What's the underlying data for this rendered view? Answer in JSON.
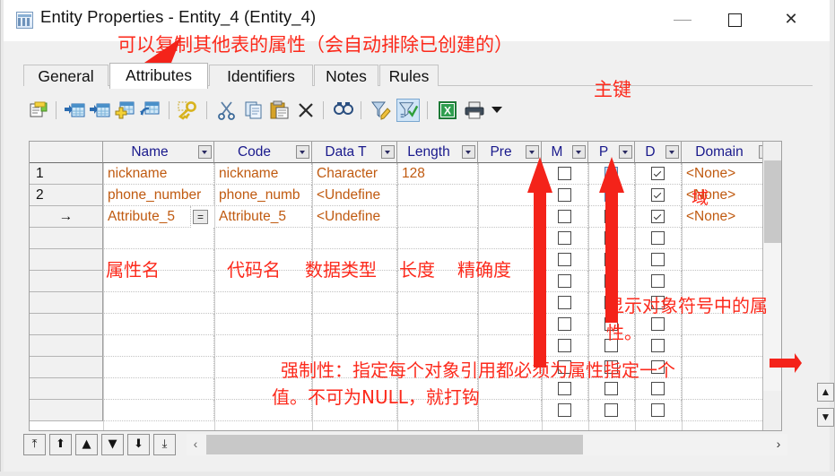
{
  "window": {
    "title": "Entity Properties - Entity_4 (Entity_4)",
    "icon": "table-window-icon",
    "minimize_label": "—",
    "maximize_label": "□",
    "close_label": "✕"
  },
  "tabs": [
    {
      "label": "General",
      "active": false
    },
    {
      "label": "Attributes",
      "active": true
    },
    {
      "label": "Identifiers",
      "active": false
    },
    {
      "label": "Notes",
      "active": false
    },
    {
      "label": "Rules",
      "active": false
    }
  ],
  "toolbar": {
    "buttons": [
      {
        "name": "properties-icon"
      },
      {
        "name": "insert-row-icon"
      },
      {
        "name": "add-row-icon"
      },
      {
        "name": "add-table-icon"
      },
      {
        "name": "replace-table-icon"
      },
      {
        "name": "primary-key-icon"
      },
      {
        "name": "cut-icon"
      },
      {
        "name": "copy-icon"
      },
      {
        "name": "paste-icon"
      },
      {
        "name": "delete-icon"
      },
      {
        "name": "find-icon"
      },
      {
        "name": "filter-edit-icon"
      },
      {
        "name": "filter-apply-icon"
      },
      {
        "name": "excel-export-icon"
      },
      {
        "name": "print-icon"
      }
    ],
    "dropdown_label": "▼"
  },
  "grid": {
    "columns": [
      {
        "label": "",
        "name": "row-number-column"
      },
      {
        "label": "Name",
        "name": "name-column"
      },
      {
        "label": "Code",
        "name": "code-column"
      },
      {
        "label": "Data T",
        "name": "data-type-column"
      },
      {
        "label": "Length",
        "name": "length-column"
      },
      {
        "label": "Pre",
        "name": "precision-column"
      },
      {
        "label": "M",
        "name": "mandatory-column"
      },
      {
        "label": "P",
        "name": "primary-key-column"
      },
      {
        "label": "D",
        "name": "displayed-column"
      },
      {
        "label": "Domain",
        "name": "domain-column"
      }
    ],
    "sort_indicator": "∧",
    "rows": [
      {
        "num": "1",
        "current": false,
        "name": "nickname",
        "code": "nickname",
        "data_type": "Character",
        "length": "128",
        "precision": "",
        "mandatory": false,
        "primary": "highlight",
        "displayed": true,
        "domain": "<None>"
      },
      {
        "num": "2",
        "current": false,
        "name": "phone_number",
        "code": "phone_numb",
        "data_type": "<Undefine",
        "length": "",
        "precision": "",
        "mandatory": false,
        "primary": "highlight",
        "displayed": true,
        "domain": "<None>"
      },
      {
        "num": "→",
        "current": true,
        "name": "Attribute_5",
        "code": "Attribute_5",
        "data_type": "<Undefine",
        "length": "",
        "precision": "",
        "mandatory": false,
        "primary": "empty",
        "displayed": true,
        "domain": "<None>",
        "ellipsis": "="
      },
      {
        "num": "",
        "current": false,
        "name": "",
        "code": "",
        "data_type": "",
        "length": "",
        "precision": "",
        "mandatory": false,
        "primary": "empty",
        "displayed": false,
        "domain": ""
      },
      {
        "num": "",
        "current": false,
        "name": "",
        "code": "",
        "data_type": "",
        "length": "",
        "precision": "",
        "mandatory": false,
        "primary": "empty",
        "displayed": false,
        "domain": ""
      },
      {
        "num": "",
        "current": false,
        "name": "",
        "code": "",
        "data_type": "",
        "length": "",
        "precision": "",
        "mandatory": false,
        "primary": "empty",
        "displayed": false,
        "domain": ""
      },
      {
        "num": "",
        "current": false,
        "name": "",
        "code": "",
        "data_type": "",
        "length": "",
        "precision": "",
        "mandatory": false,
        "primary": "empty",
        "displayed": false,
        "domain": ""
      },
      {
        "num": "",
        "current": false,
        "name": "",
        "code": "",
        "data_type": "",
        "length": "",
        "precision": "",
        "mandatory": false,
        "primary": "empty",
        "displayed": false,
        "domain": ""
      },
      {
        "num": "",
        "current": false,
        "name": "",
        "code": "",
        "data_type": "",
        "length": "",
        "precision": "",
        "mandatory": false,
        "primary": "empty",
        "displayed": false,
        "domain": ""
      },
      {
        "num": "",
        "current": false,
        "name": "",
        "code": "",
        "data_type": "",
        "length": "",
        "precision": "",
        "mandatory": false,
        "primary": "empty",
        "displayed": false,
        "domain": ""
      },
      {
        "num": "",
        "current": false,
        "name": "",
        "code": "",
        "data_type": "",
        "length": "",
        "precision": "",
        "mandatory": false,
        "primary": "empty",
        "displayed": false,
        "domain": ""
      },
      {
        "num": "",
        "current": false,
        "name": "",
        "code": "",
        "data_type": "",
        "length": "",
        "precision": "",
        "mandatory": false,
        "primary": "empty",
        "displayed": false,
        "domain": ""
      }
    ],
    "scroll_up": "∧",
    "scroll_top_label": "▲",
    "scroll_bottom_label": "▼"
  },
  "bottom_nav": {
    "buttons": [
      {
        "name": "move-to-first-button",
        "glyph": "⤒"
      },
      {
        "name": "move-up-fast-button",
        "glyph": "⬆"
      },
      {
        "name": "move-up-button",
        "glyph": "▲"
      },
      {
        "name": "move-down-button",
        "glyph": "▼"
      },
      {
        "name": "move-down-fast-button",
        "glyph": "⬇"
      },
      {
        "name": "move-to-last-button",
        "glyph": "⤓"
      }
    ],
    "scroll_left": "‹",
    "scroll_right": "›"
  },
  "annotations": {
    "copy_attributes": "可以复制其他表的属性（会自动排除已创建的）",
    "primary_key": "主键",
    "domain": "域",
    "attribute_name": "属性名",
    "code_name": "代码名",
    "data_type": "数据类型",
    "length": "长度",
    "precision": "精确度",
    "displayed_line1": "显示对象符号中的属",
    "displayed_line2": "性。",
    "mandatory_line1": "强制性：指定每个对象引用都必须为属性指定一个",
    "mandatory_line2": "值。不可为NULL，就打钩"
  },
  "colors": {
    "annotation": "#fc2a1c",
    "header_text": "#19198c",
    "cell_text": "#c05a10",
    "pk_checkbox": "#bcd9f2"
  }
}
